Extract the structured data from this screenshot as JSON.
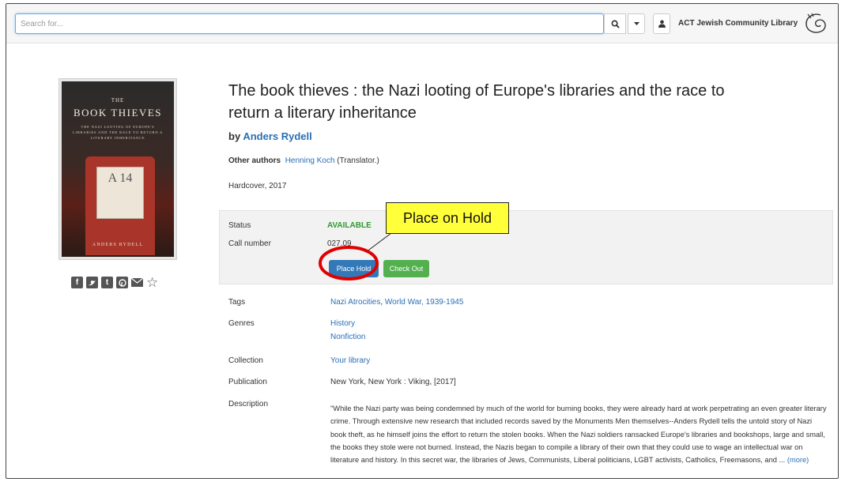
{
  "search": {
    "placeholder": "Search for..."
  },
  "header": {
    "library_name": "ACT Jewish Community Library"
  },
  "cover": {
    "the": "THE",
    "title": "BOOK THIEVES",
    "subtitle": "THE NAZI LOOTING OF EUROPE'S LIBRARIES AND THE RACE TO RETURN A LITERARY INHERITANCE",
    "label": "A 14",
    "author": "ANDERS RYDELL"
  },
  "book": {
    "title": "The book thieves : the Nazi looting of Europe's libraries and the race to return a literary inheritance",
    "by_prefix": "by",
    "author": "Anders Rydell",
    "other_authors_label": "Other authors",
    "other_author": "Henning Koch",
    "other_author_role": "(Translator.)",
    "format": "Hardcover, 2017"
  },
  "availability": {
    "status_label": "Status",
    "status_value": "AVAILABLE",
    "call_number_label": "Call number",
    "call_number_value": "027.09",
    "place_hold": "Place Hold",
    "check_out": "Check Out"
  },
  "annotation": {
    "callout_text": "Place on Hold"
  },
  "details": {
    "tags_label": "Tags",
    "tags": [
      "Nazi Atrocities",
      "World War, 1939-1945"
    ],
    "genres_label": "Genres",
    "genres": [
      "History",
      "Nonfiction"
    ],
    "collection_label": "Collection",
    "collection": "Your library",
    "publication_label": "Publication",
    "publication": "New York, New York : Viking, [2017]",
    "description_label": "Description",
    "description": "\"While the Nazi party was being condemned by much of the world for burning books, they were already hard at work perpetrating an even greater literary crime. Through extensive new research that included records saved by the Monuments Men themselves--Anders Rydell tells the untold story of Nazi book theft, as he himself joins the effort to return the stolen books. When the Nazi soldiers ransacked Europe's libraries and bookshops, large and small, the books they stole were not burned. Instead, the Nazis began to compile a library of their own that they could use to wage an intellectual war on literature and history. In this secret war, the libraries of Jews, Communists, Liberal politicians, LGBT activists, Catholics, Freemasons, and ...",
    "more": "(more)"
  },
  "colors": {
    "link": "#2a6fb5",
    "available": "#2e9a2e",
    "primary_button": "#3379b8",
    "success_button": "#54b04f",
    "callout": "#ffff3a",
    "highlight_ring": "#e00000"
  },
  "icons": {
    "search": "search-icon",
    "caret": "caret-down-icon",
    "user": "user-icon",
    "share": [
      "facebook-icon",
      "twitter-icon",
      "tumblr-icon",
      "pinterest-icon",
      "email-icon",
      "star-icon"
    ]
  }
}
